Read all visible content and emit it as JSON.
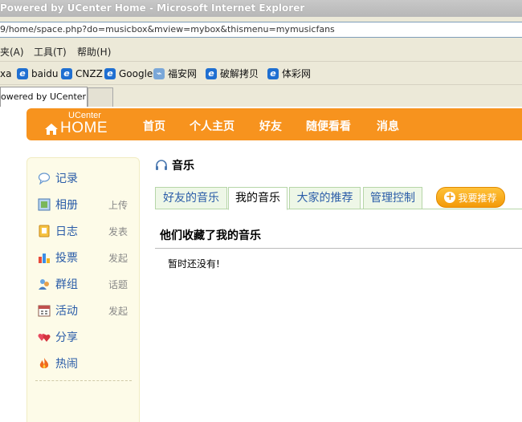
{
  "window": {
    "title": "Powered by UCenter Home - Microsoft Internet Explorer"
  },
  "address": {
    "url": "9/home/space.php?do=musicbox&mview=mybox&thismenu=mymusicfans"
  },
  "menu": {
    "favorites": "夹(A)",
    "tools": "工具(T)",
    "help": "帮助(H)"
  },
  "links": [
    {
      "label": "xa"
    },
    {
      "label": "baidu"
    },
    {
      "label": "CNZZ"
    },
    {
      "label": "Google"
    },
    {
      "label": "福安网"
    },
    {
      "label": "破解拷贝"
    },
    {
      "label": "体彩网"
    }
  ],
  "browser_tab": {
    "label": "owered by UCenter ..."
  },
  "logo": {
    "top": "UCenter",
    "main": "HOME"
  },
  "nav": [
    "首页",
    "个人主页",
    "好友",
    "随便看看",
    "消息"
  ],
  "sidebar": [
    {
      "label": "记录",
      "sub": "",
      "icon": "speech-bubble-icon"
    },
    {
      "label": "相册",
      "sub": "上传",
      "icon": "photo-icon"
    },
    {
      "label": "日志",
      "sub": "发表",
      "icon": "notebook-icon"
    },
    {
      "label": "投票",
      "sub": "发起",
      "icon": "bar-chart-icon"
    },
    {
      "label": "群组",
      "sub": "话题",
      "icon": "group-icon"
    },
    {
      "label": "活动",
      "sub": "发起",
      "icon": "calendar-icon"
    },
    {
      "label": "分享",
      "sub": "",
      "icon": "hearts-icon"
    },
    {
      "label": "热闹",
      "sub": "",
      "icon": "flame-icon"
    }
  ],
  "section": {
    "title": "音乐"
  },
  "tabs": [
    "好友的音乐",
    "我的音乐",
    "大家的推荐",
    "管理控制"
  ],
  "recommend_button": "我要推荐",
  "content": {
    "heading": "他们收藏了我的音乐",
    "empty_text": "暂时还没有!"
  },
  "colors": {
    "header": "#f7931e",
    "sidebar_bg": "#fdfbe8",
    "link": "#2a5ca8",
    "tab_bg": "#eef7e7"
  }
}
